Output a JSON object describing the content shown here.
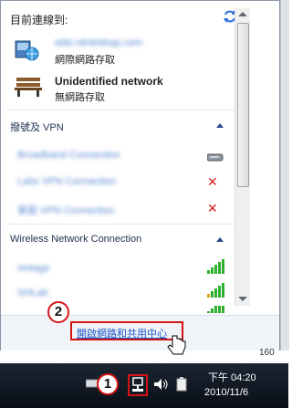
{
  "flyout": {
    "current_label": "目前連線到:",
    "networks": [
      {
        "name": "at&t.ntinkidsap.com",
        "status": "網際網路存取",
        "icon": "network-globe-icon"
      },
      {
        "name": "Unidentified network",
        "status": "無網路存取",
        "icon": "park-bench-icon"
      }
    ],
    "vpn_section": {
      "title": "撥號及 VPN",
      "items": [
        {
          "name": "Broadband Connection",
          "status_icon": "modem-icon"
        },
        {
          "name": "Labs VPN Connection",
          "status_icon": "disconnected-x-icon"
        },
        {
          "name": "家庭 VPN Connection",
          "status_icon": "disconnected-x-icon"
        }
      ]
    },
    "wireless_section": {
      "title": "Wireless Network Connection",
      "items": [
        {
          "name": "vintage",
          "status_icon": "signal-bars-icon"
        },
        {
          "name": "SHLab",
          "status_icon": "secured-signal-icon"
        },
        {
          "name": "",
          "status_icon": "signal-bars-icon"
        }
      ]
    },
    "open_center_link": "開啟網路和共用中心"
  },
  "callouts": {
    "one": "1",
    "two": "2"
  },
  "side_number": "160",
  "taskbar": {
    "time": "下午 04:20",
    "date": "2010/11/6"
  },
  "colors": {
    "annotation": "#d41414",
    "link": "#1a56c6",
    "taskbar": "#0a0f18"
  }
}
